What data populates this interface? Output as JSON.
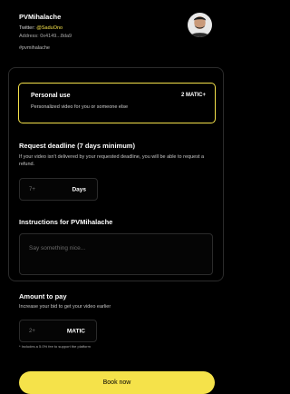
{
  "theme": {
    "accent": "#F5E24A",
    "background": "#000000",
    "border": "#2b2b2b"
  },
  "creator": {
    "name": "PVMihalache",
    "twitter_label": "Twitter:",
    "twitter_handle": "@SaduOno",
    "address_label": "Address:",
    "address_value": "0x4149...8da9",
    "hashtag": "#pvmihalache",
    "avatar_icon": "person-avatar-icon"
  },
  "option": {
    "title": "Personal use",
    "price": "2 MATIC+",
    "description": "Personalized video for you or someone else"
  },
  "deadline": {
    "label": "Request deadline (7 days minimum)",
    "note": "If your video isn't delivered by your requested deadline, you will be able to request a refund.",
    "placeholder": "7+",
    "unit": "Days"
  },
  "instructions": {
    "label": "Instructions for PVMihalache",
    "placeholder": "Say something nice..."
  },
  "amount": {
    "label": "Amount to pay",
    "note": "Increase your bid to get your video earlier",
    "placeholder": "2+",
    "unit": "MATIC",
    "fee_note": "* Includes a 5.0% fee to support the platform"
  },
  "cta": {
    "label": "Book now"
  }
}
